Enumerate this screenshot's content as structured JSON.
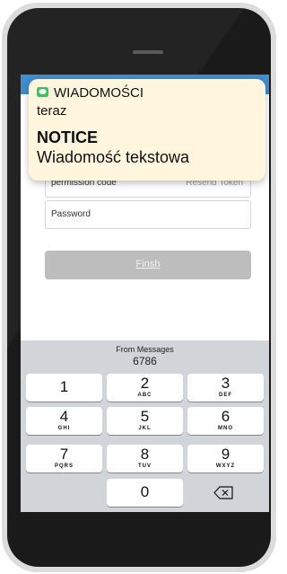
{
  "notification": {
    "app_name": "WIADOMOŚCI",
    "time": "teraz",
    "title": "NOTICE",
    "body": "Wiadomość tekstowa",
    "icon": "messages-icon"
  },
  "form": {
    "verification_placeholder": "permission code",
    "verification_extra": "Resend Token",
    "password_placeholder": "Password",
    "finish_label": "Finsh"
  },
  "keyboard": {
    "suggestion_source": "From Messages",
    "suggestion_code": "6786",
    "keys": [
      {
        "digit": "1",
        "letters": ""
      },
      {
        "digit": "2",
        "letters": "ABC"
      },
      {
        "digit": "3",
        "letters": "DEF"
      },
      {
        "digit": "4",
        "letters": "GHI"
      },
      {
        "digit": "5",
        "letters": "JKL"
      },
      {
        "digit": "6",
        "letters": "MNO"
      },
      {
        "digit": "7",
        "letters": "PQRS"
      },
      {
        "digit": "8",
        "letters": "TUV"
      },
      {
        "digit": "9",
        "letters": "WXYZ"
      },
      {
        "digit": "0",
        "letters": ""
      }
    ],
    "backspace_icon": "backspace-icon"
  },
  "colors": {
    "status_bar": "#3e8ed0",
    "notification_bg": "#fff6dd",
    "message_icon": "#34c759",
    "finish_button": "#bdbdbd",
    "keyboard_bg": "#d1d4d9"
  }
}
